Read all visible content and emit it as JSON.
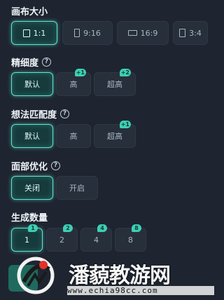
{
  "canvas_size": {
    "title": "画布大小",
    "options": [
      {
        "label": "1:1",
        "icon": "square-ratio-icon",
        "active": true
      },
      {
        "label": "9:16",
        "icon": "portrait-ratio-icon",
        "active": false
      },
      {
        "label": "16:9",
        "icon": "landscape-ratio-icon",
        "active": false
      },
      {
        "label": "3:4",
        "icon": "portrait-ratio-icon",
        "active": false
      }
    ]
  },
  "detail": {
    "title": "精细度",
    "options": [
      {
        "label": "默认",
        "active": true,
        "badge": ""
      },
      {
        "label": "高",
        "active": false,
        "badge": "+1"
      },
      {
        "label": "超高",
        "active": false,
        "badge": "+2"
      }
    ]
  },
  "idea_match": {
    "title": "想法匹配度",
    "options": [
      {
        "label": "默认",
        "active": true,
        "badge": ""
      },
      {
        "label": "高",
        "active": false,
        "badge": ""
      },
      {
        "label": "超高",
        "active": false,
        "badge": "+1"
      }
    ]
  },
  "face_opt": {
    "title": "面部优化",
    "options": [
      {
        "label": "关闭",
        "active": true
      },
      {
        "label": "开启",
        "active": false
      }
    ]
  },
  "gen_count": {
    "title": "生成数量",
    "options": [
      {
        "label": "1",
        "active": true,
        "badge": "1"
      },
      {
        "label": "2",
        "active": false,
        "badge": "2"
      },
      {
        "label": "4",
        "active": false,
        "badge": "4"
      },
      {
        "label": "8",
        "active": false,
        "badge": "8"
      }
    ]
  },
  "watermark": {
    "title": "潘藐教游网",
    "url": "www.echia98cc.com"
  },
  "colors": {
    "accent": "#5fe3cf",
    "background": "#1e2530",
    "button": "#272f3b",
    "badge": "#3ecfb4"
  }
}
